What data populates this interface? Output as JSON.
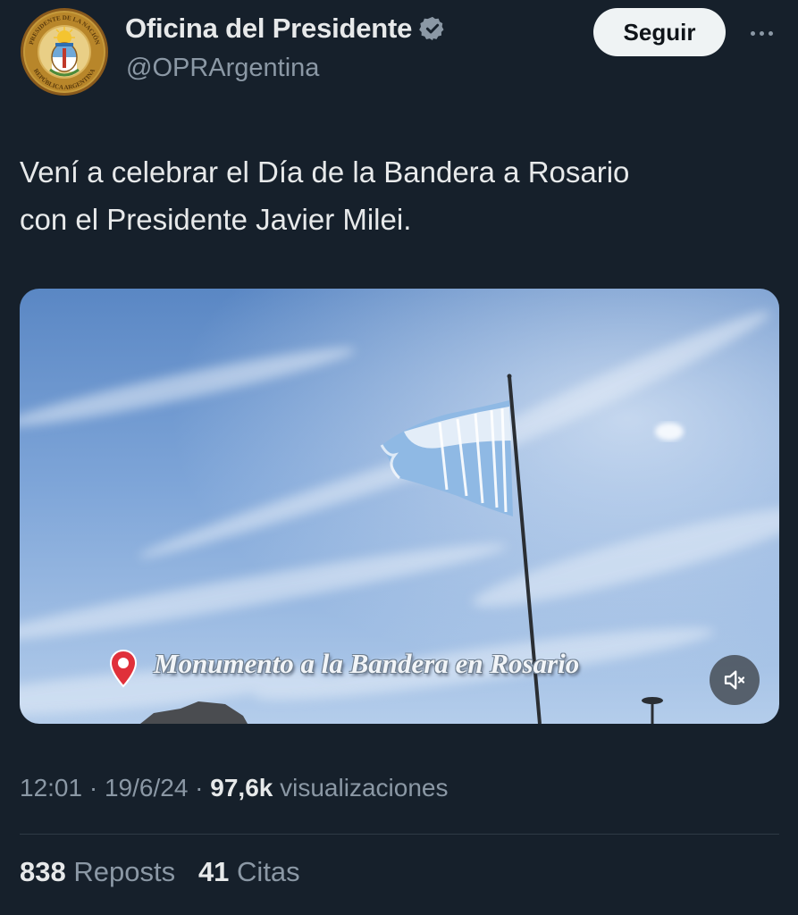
{
  "header": {
    "display_name": "Oficina del Presidente",
    "handle": "@OPRArgentina",
    "follow_label": "Seguir",
    "avatar_icon": "presidential-seal-icon",
    "avatar_ring_text_top": "PRESIDENTE DE LA NACIÓN",
    "avatar_ring_text_bottom": "REPÚBLICA ARGENTINA",
    "verified_icon": "verified-badge-icon",
    "more_icon": "more-options-icon"
  },
  "tweet": {
    "text_line1": "Vení a celebrar el Día de la Bandera a Rosario",
    "text_line2": "con el Presidente Javier Milei."
  },
  "media": {
    "location_caption": "Monumento a la Bandera en Rosario",
    "pin_icon": "location-pin-icon",
    "mute_icon": "muted-speaker-icon"
  },
  "meta": {
    "time": "12:01",
    "separator": " · ",
    "date": "19/6/24",
    "views_count": "97,6k",
    "views_label": "visualizaciones"
  },
  "stats": {
    "reposts_count": "838",
    "reposts_label": "Reposts",
    "quotes_count": "41",
    "quotes_label": "Citas"
  },
  "colors": {
    "background": "#16202b",
    "text_primary": "#e7e9ea",
    "text_secondary": "#8b98a5",
    "verified": "#8b98a5",
    "follow_bg": "#eff3f4",
    "pin_red": "#e0303a"
  }
}
